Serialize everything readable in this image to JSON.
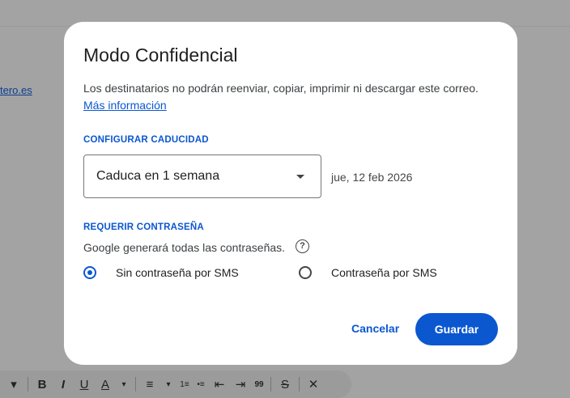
{
  "background": {
    "link_fragment": "tero.es",
    "toolbar": [
      "▾",
      "B",
      "I",
      "U",
      "A",
      "▾",
      "≡",
      "▾",
      "1≡",
      "•≡",
      "⇤",
      "⇥",
      "99",
      "S",
      "✕"
    ]
  },
  "dialog": {
    "title": "Modo Confidencial",
    "description": "Los destinatarios no podrán reenviar, copiar, imprimir ni descargar este correo.",
    "more_link": "Más información",
    "expiry_section": "CONFIGURAR CADUCIDAD",
    "expiry_value": "Caduca en 1 semana",
    "expiry_date": "jue, 12 feb 2026",
    "password_section": "REQUERIR CONTRASEÑA",
    "password_note": "Google generará todas las contraseñas.",
    "help_glyph": "?",
    "option_no_sms": "Sin contraseña por SMS",
    "option_sms": "Contraseña por SMS",
    "selected_option": "option_no_sms",
    "cancel_label": "Cancelar",
    "save_label": "Guardar"
  },
  "colors": {
    "accent": "#0b57d0",
    "overlay": "#a3a3a3",
    "dialog_bg": "#ffffff"
  }
}
